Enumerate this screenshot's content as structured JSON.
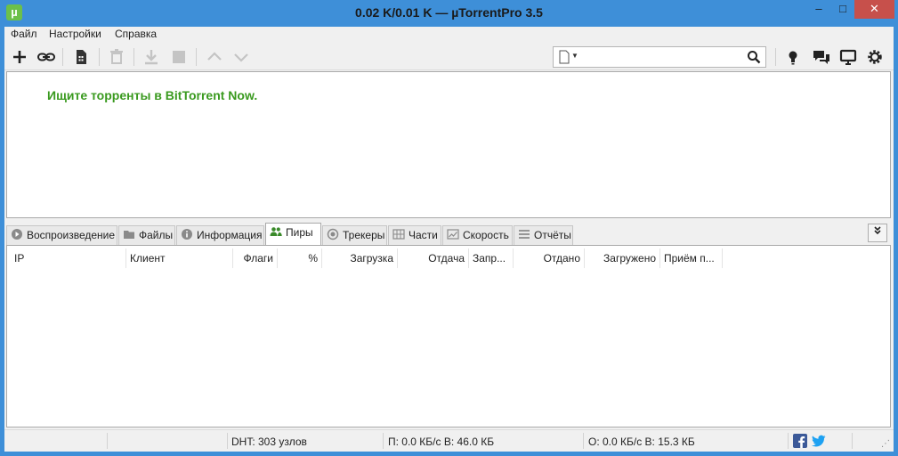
{
  "window": {
    "title": "0.02 K/0.01 K — µTorrentPro 3.5",
    "icon": "µ",
    "minimize": "–",
    "maximize": "□",
    "close": "✕"
  },
  "menu": [
    "Файл",
    "Настройки",
    "Справка"
  ],
  "toolbar": {
    "icons": [
      "plus-icon",
      "link-icon",
      "create-torrent-icon",
      "delete-icon",
      "download-icon",
      "stop-icon",
      "move-up-icon",
      "move-down-icon"
    ],
    "right_icons": [
      "bulb-icon",
      "chat-icon",
      "remote-icon",
      "settings-icon"
    ]
  },
  "search": {
    "value": "",
    "placeholder": ""
  },
  "promo": {
    "text": "Ищите торренты в BitTorrent Now."
  },
  "tabs": [
    {
      "label": "Воспроизведение",
      "icon": "play-icon"
    },
    {
      "label": "Файлы",
      "icon": "folder-icon"
    },
    {
      "label": "Информация",
      "icon": "info-icon"
    },
    {
      "label": "Пиры",
      "icon": "peers-icon",
      "active": true
    },
    {
      "label": "Трекеры",
      "icon": "tracker-icon"
    },
    {
      "label": "Части",
      "icon": "pieces-icon"
    },
    {
      "label": "Скорость",
      "icon": "speed-icon"
    },
    {
      "label": "Отчёты",
      "icon": "log-icon"
    }
  ],
  "peers_table": {
    "columns": [
      "IP",
      "Клиент",
      "Флаги",
      "%",
      "Загрузка",
      "Отдача",
      "Запр...",
      "Отдано",
      "Загружено",
      "Приём п..."
    ],
    "rows": []
  },
  "status": {
    "dht": "DHT: 303 узлов",
    "download": "П: 0.0 КБ/с В: 46.0 КБ",
    "upload": "О: 0.0 КБ/с В: 15.3 КБ"
  },
  "colors": {
    "titlebar": "#3e8fd8",
    "promo": "#3a9a1f",
    "close_button": "#c7504b",
    "facebook": "#3b5998",
    "twitter": "#1da1f2"
  }
}
